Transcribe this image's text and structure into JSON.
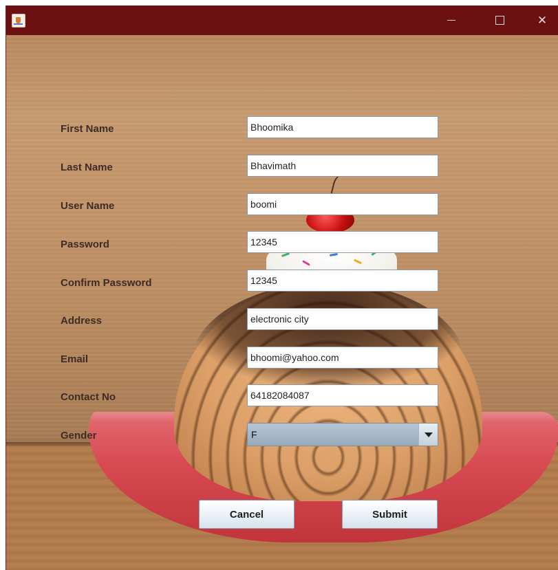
{
  "window": {
    "title": "",
    "controls": {
      "minimize_icon": "minimize-icon",
      "maximize_icon": "maximize-icon",
      "close_icon": "close-icon",
      "close_glyph": "✕"
    }
  },
  "form": {
    "fields": [
      {
        "label": "First Name",
        "value": "Bhoomika"
      },
      {
        "label": "Last Name",
        "value": "Bhavimath"
      },
      {
        "label": "User Name",
        "value": "boomi"
      },
      {
        "label": "Password",
        "value": "12345"
      },
      {
        "label": "Confirm Password",
        "value": "12345"
      },
      {
        "label": "Address",
        "value": "electronic city"
      },
      {
        "label": "Email",
        "value": "bhoomi@yahoo.com"
      },
      {
        "label": "Contact No",
        "value": "64182084087"
      }
    ],
    "gender": {
      "label": "Gender",
      "selected": "F"
    },
    "buttons": {
      "cancel": "Cancel",
      "submit": "Submit"
    }
  }
}
